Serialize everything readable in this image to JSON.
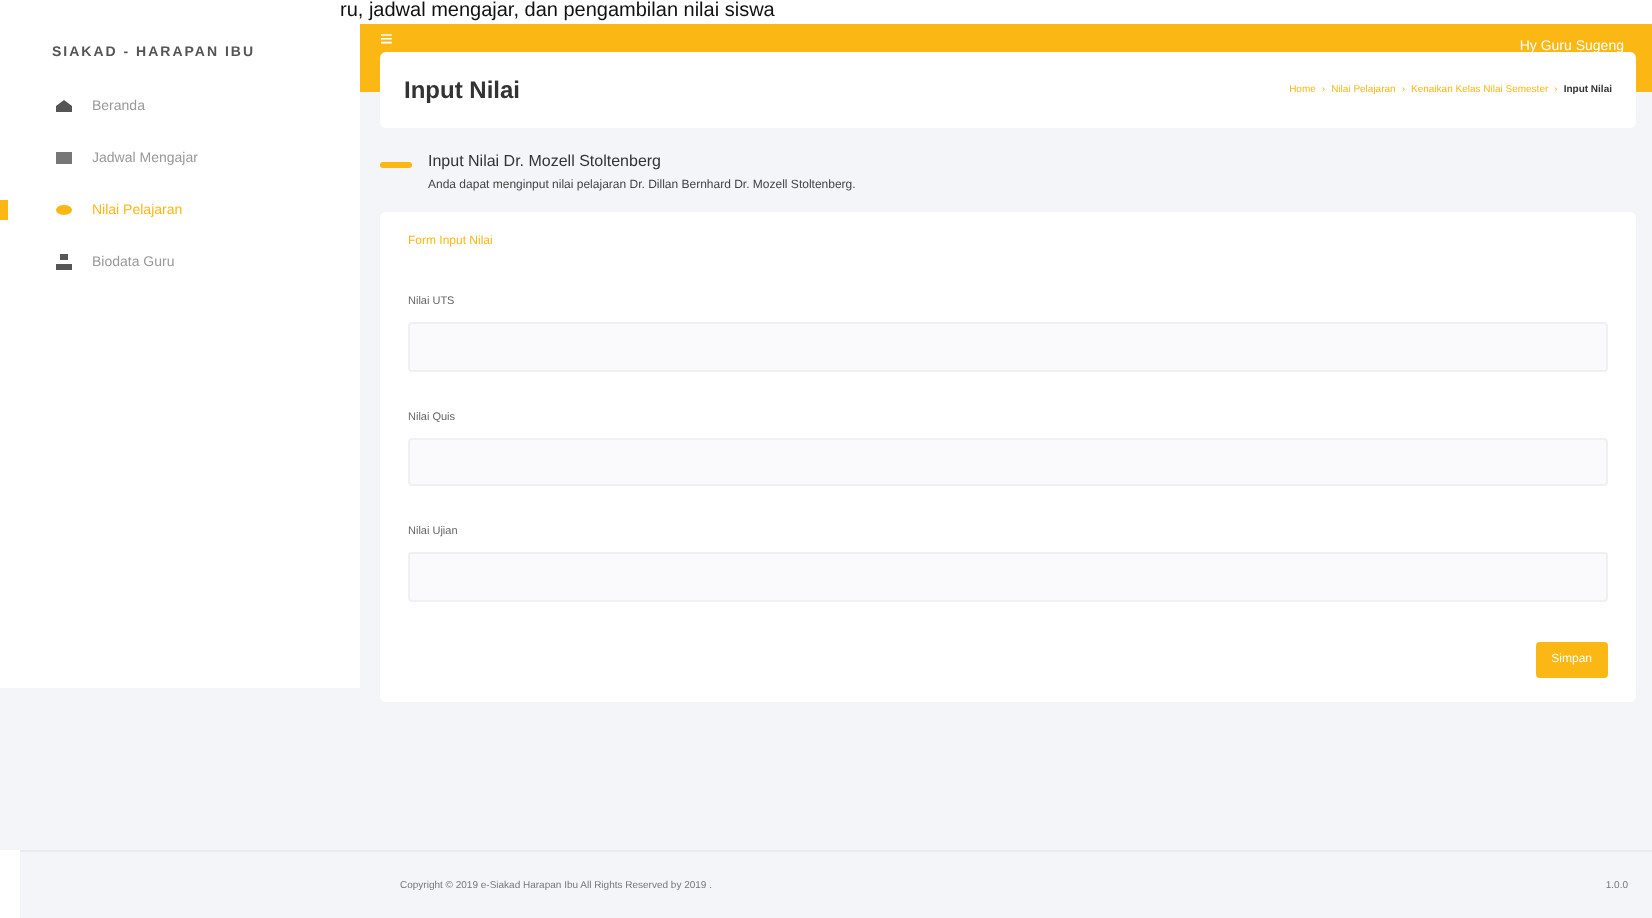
{
  "document_caption": "ru, jadwal mengajar, dan pengambilan nilai siswa",
  "sidebar": {
    "brand": "SIAKAD - HARAPAN IBU",
    "items": [
      {
        "label": "Beranda",
        "selected": false
      },
      {
        "label": "Jadwal Mengajar",
        "selected": false
      },
      {
        "label": "Nilai Pelajaran",
        "selected": true
      },
      {
        "label": "Biodata Guru",
        "selected": false
      }
    ]
  },
  "topbar": {
    "menu_icon": "≡",
    "user": "Hy Guru Sugeng"
  },
  "page_header": {
    "title": "Input Nilai",
    "breadcrumb": [
      "Home",
      "Nilai Pelajaran",
      "Kenaikan Kelas Nilai Semester"
    ],
    "breadcrumb_separator": "›",
    "breadcrumb_current": "Input Nilai"
  },
  "section": {
    "title": "Input Nilai Dr. Mozell Stoltenberg",
    "subtitle": "Anda dapat menginput nilai pelajaran Dr. Dillan Bernhard Dr. Mozell Stoltenberg."
  },
  "form": {
    "title": "Form Input Nilai",
    "fields": [
      {
        "label": "Nilai UTS"
      },
      {
        "label": "Nilai Quis"
      },
      {
        "label": "Nilai Ujian"
      }
    ],
    "submit": "Simpan"
  },
  "footer": {
    "copyright": "Copyright © 2019 e-Siakad Harapan Ibu All Rights Reserved by 2019 .",
    "version": "1.0.0"
  }
}
